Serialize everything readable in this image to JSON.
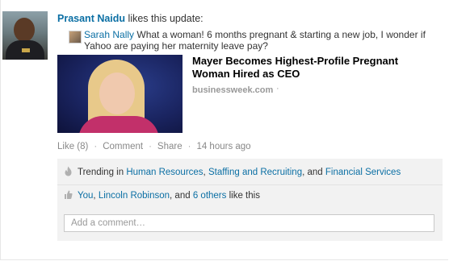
{
  "activity": {
    "actor_name": "Prasant Naidu",
    "action_text": "likes this update:"
  },
  "share": {
    "author": "Sarah Nally",
    "text": "What a woman! 6 months pregnant & starting a new job, I wonder if Yahoo are paying her maternity leave pay?"
  },
  "article": {
    "title": "Mayer Becomes Highest-Profile Pregnant Woman Hired as CEO",
    "source": "businessweek.com",
    "source_separator": "·"
  },
  "actions": {
    "like": "Like (8)",
    "comment": "Comment",
    "share": "Share",
    "timestamp": "14 hours ago",
    "separator": "·"
  },
  "trending": {
    "prefix": "Trending in",
    "topic1": "Human Resources",
    "comma1": ",",
    "topic2": "Staffing and Recruiting",
    "joiner": ", and",
    "topic3": "Financial Services"
  },
  "likes": {
    "you": "You",
    "comma": ",",
    "person": "Lincoln Robinson",
    "joiner": ", and",
    "others": "6 others",
    "suffix": "like this"
  },
  "comment_input": {
    "placeholder": "Add a comment…",
    "value": ""
  },
  "colors": {
    "link": "#0b6fa4",
    "muted": "#888888",
    "panel_bg": "#f2f2f2"
  },
  "icons": {
    "trending": "flame-icon",
    "likes": "thumbs-up-icon"
  }
}
